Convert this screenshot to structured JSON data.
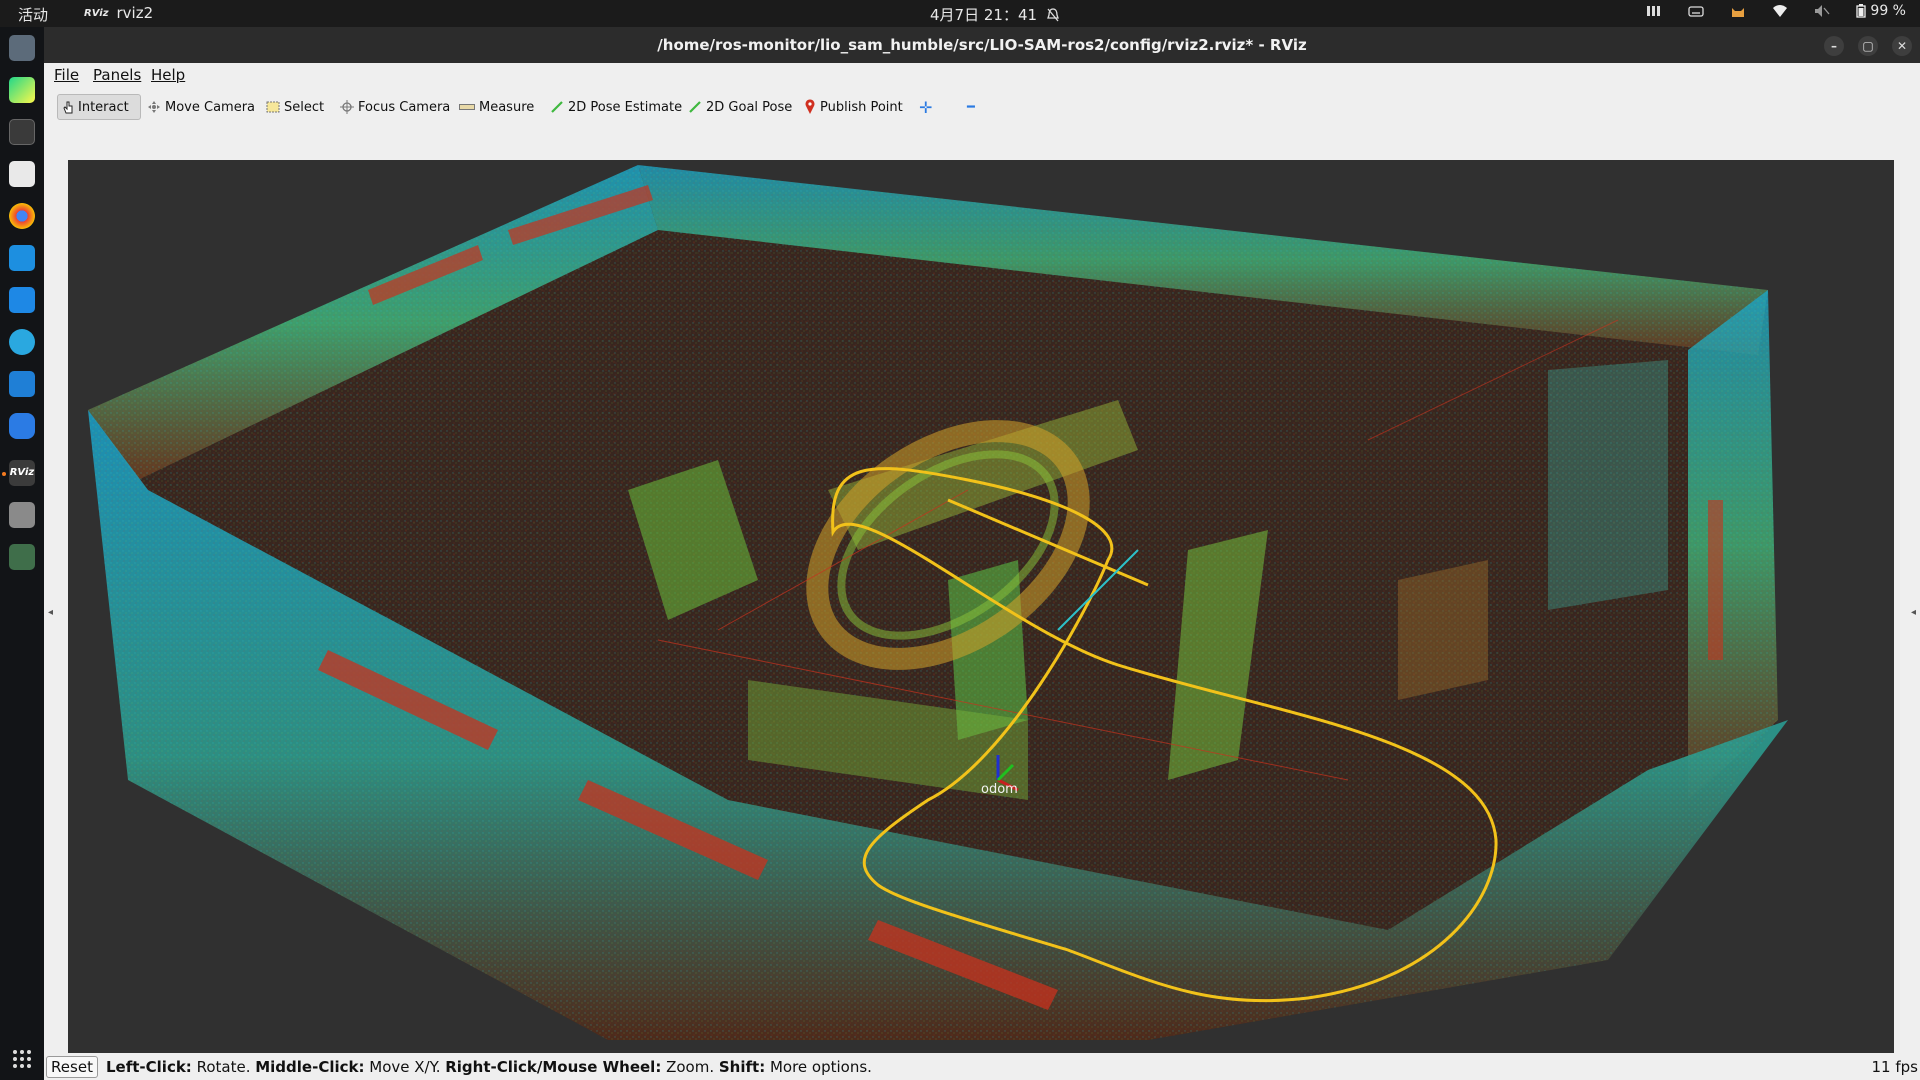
{
  "topbar": {
    "activities": "活动",
    "app_name": "rviz2",
    "app_badge": "RViz",
    "clock": "4月7日  21：41",
    "battery": "99 %"
  },
  "window": {
    "title": "/home/ros-monitor/lio_sam_humble/src/LIO-SAM-ros2/config/rviz2.rviz* - RViz",
    "minimize_glyph": "–",
    "maximize_glyph": "▢",
    "close_glyph": "✕"
  },
  "menubar": {
    "items": [
      "File",
      "Panels",
      "Help"
    ]
  },
  "toolbar": {
    "tools": [
      "Interact",
      "Move Camera",
      "Select",
      "Focus Camera",
      "Measure",
      "2D Pose Estimate",
      "2D Goal Pose",
      "Publish Point"
    ],
    "add_glyph": "✛",
    "remove_glyph": "━"
  },
  "viewport": {
    "frame_label": "odom",
    "left_arrow": "◂",
    "right_arrow": "◂"
  },
  "statusbar": {
    "reset_label": "Reset",
    "hint_left_click_key": "Left-Click:",
    "hint_left_click_val": " Rotate. ",
    "hint_middle_key": "Middle-Click:",
    "hint_middle_val": " Move X/Y. ",
    "hint_right_key": "Right-Click/Mouse Wheel:",
    "hint_right_val": " Zoom. ",
    "hint_shift_key": "Shift:",
    "hint_shift_val": " More options.",
    "fps": "11 fps"
  },
  "colors": {
    "trajectory": "#f2c21a",
    "cloud_blue": "#1aa3c7",
    "cloud_green": "#5fd34a",
    "cloud_red": "#c8321e",
    "viewport_bg": "#303030"
  }
}
